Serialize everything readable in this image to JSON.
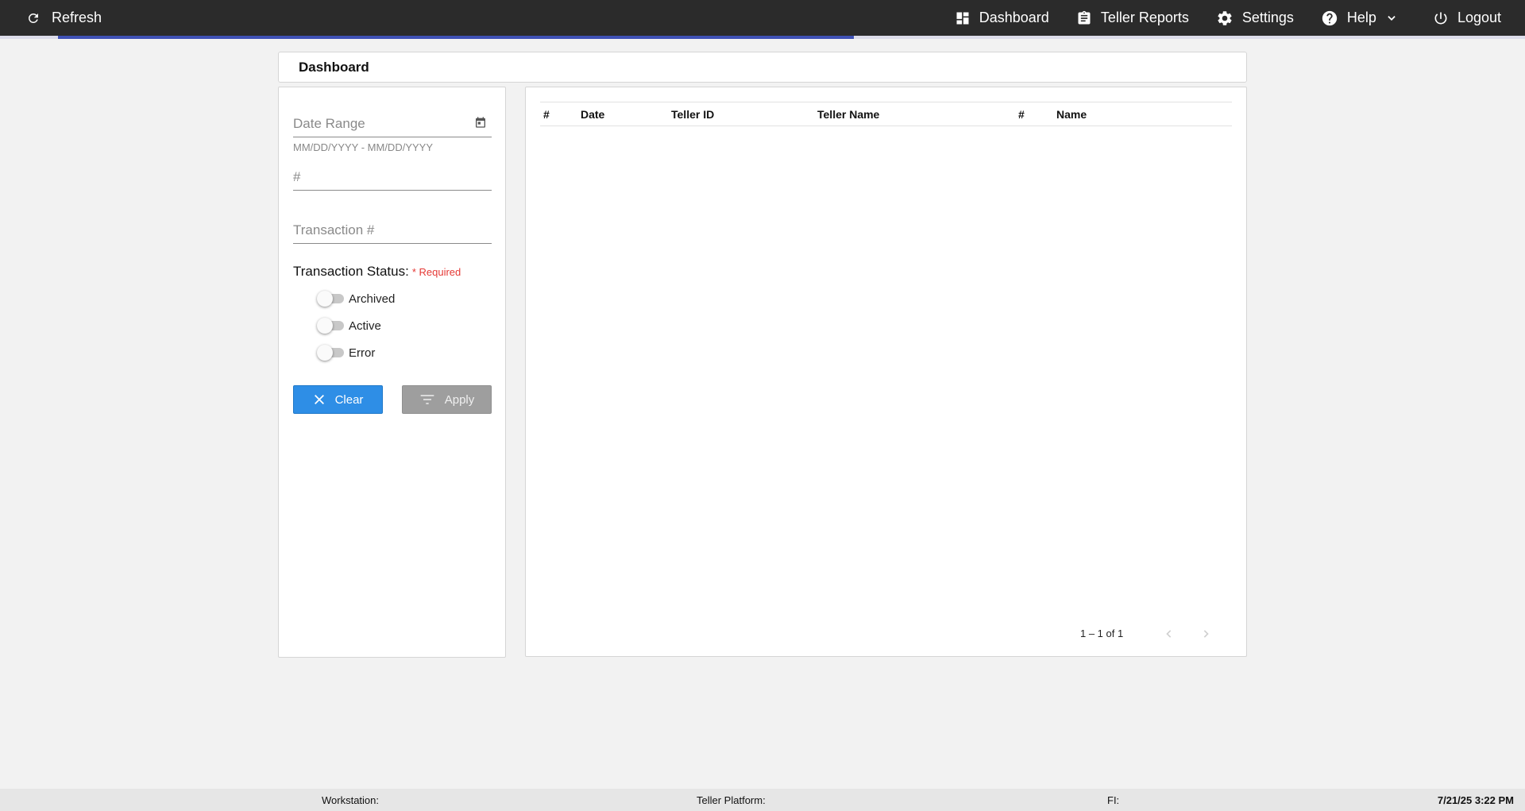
{
  "topbar": {
    "refresh_label": "Refresh",
    "nav": {
      "dashboard": "Dashboard",
      "teller_reports": "Teller Reports",
      "settings": "Settings",
      "help": "Help",
      "logout": "Logout"
    },
    "icons": [
      "refresh-icon",
      "dashboard-icon",
      "clipboard-icon",
      "gear-icon",
      "help-circle-icon",
      "chevron-down-icon",
      "power-icon"
    ]
  },
  "breadcrumb": {
    "title": "Dashboard"
  },
  "filters": {
    "date_range": {
      "placeholder": "Date Range",
      "hint": "MM/DD/YYYY - MM/DD/YYYY"
    },
    "number": {
      "placeholder": "#"
    },
    "transaction_number": {
      "placeholder": "Transaction #"
    },
    "status": {
      "label": "Transaction Status:",
      "required": "* Required",
      "options": [
        {
          "label": "Archived",
          "checked": false
        },
        {
          "label": "Active",
          "checked": false
        },
        {
          "label": "Error",
          "checked": false
        }
      ]
    },
    "clear_label": "Clear",
    "apply_label": "Apply"
  },
  "table": {
    "columns": [
      "#",
      "Date",
      "Teller ID",
      "Teller Name",
      "#",
      "Name"
    ],
    "rows": [],
    "paginator": {
      "range": "1 – 1 of 1"
    }
  },
  "footer": {
    "workstation": "Workstation:",
    "teller_platform": "Teller Platform:",
    "fi": "FI:",
    "timestamp": "7/21/25 3:22 PM"
  },
  "colors": {
    "topbar": "#2b2b2b",
    "progress": "#3f51b5",
    "clear_button": "#2e8ee6",
    "apply_button": "#9e9e9e",
    "required": "#e53935"
  }
}
